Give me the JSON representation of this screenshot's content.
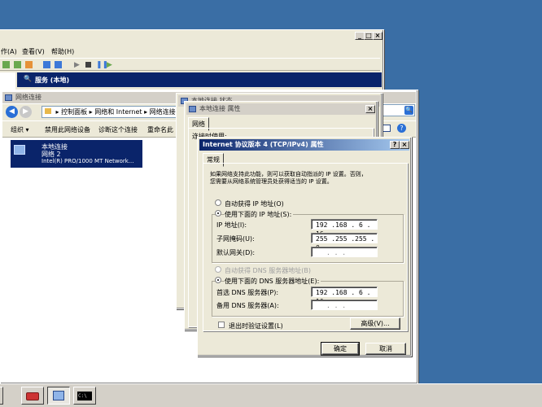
{
  "server_manager": {
    "menu": [
      "作(A)",
      "查看(V)",
      "帮助(H)"
    ],
    "services_header": "服务 (本地)"
  },
  "net_connections": {
    "title": "网络连接",
    "breadcrumb": [
      "控制面板",
      "网络和 Internet",
      "网络连接"
    ],
    "toolbar": [
      "组织",
      "禁用此网络设备",
      "诊断这个连接",
      "重命名此"
    ],
    "adapter": {
      "name": "本地连接",
      "network": "网络  2",
      "device": "Intel(R) PRO/1000 MT Network..."
    }
  },
  "status_window": {
    "title": "本地连接 状态"
  },
  "props_window": {
    "title": "本地连接 属性",
    "tab": "网络",
    "partial_label": "连接时使用:"
  },
  "ipv4_dialog": {
    "title": "Internet 协议版本 4 (TCP/IPv4) 属性",
    "tab": "常规",
    "description": [
      "如果网络支持此功能，则可以获取自动指派的 IP 设置。否则，",
      "您需要从网络系统管理员处获得适当的 IP 设置。"
    ],
    "auto_ip": "自动获得 IP 地址(O)",
    "manual_ip": "使用下面的 IP 地址(S):",
    "ip_label": "IP 地址(I):",
    "ip_value": "192 .168 . 6  . 16",
    "mask_label": "子网掩码(U):",
    "mask_value": "255 .255 .255 . 0",
    "gateway_label": "默认网关(D):",
    "gateway_value": ".      .      .",
    "auto_dns": "自动获得 DNS 服务器地址(B)",
    "manual_dns": "使用下面的 DNS 服务器地址(E):",
    "pref_dns_label": "首选 DNS 服务器(P):",
    "pref_dns_value": "192 .168 . 6  . 10",
    "alt_dns_label": "备用 DNS 服务器(A):",
    "alt_dns_value": ".      .      .",
    "validate_label": "退出时验证设置(L)",
    "advanced_button": "高级(V)...",
    "ok_button": "确定",
    "cancel_button": "取消",
    "help_button": "?",
    "close_button": "×"
  },
  "colors": {
    "desktop": "#3a6ea5",
    "titlebar_active": "#0a246a",
    "services_banner": "#0a246a"
  }
}
